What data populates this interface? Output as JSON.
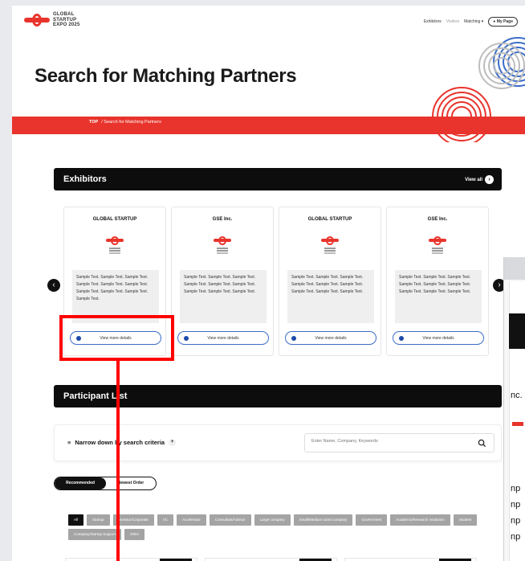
{
  "header": {
    "logo_text": [
      "GLOBAL",
      "STARTUP",
      "EXPO 2025"
    ],
    "nav": [
      "Exhibitors",
      "Visitors",
      "Matching",
      "My Page"
    ]
  },
  "hero": {
    "title": "Search for Matching Partners"
  },
  "breadcrumb": {
    "top": "TOP",
    "current": "Search for Matching Partners"
  },
  "exhibitors": {
    "title": "Exhibitors",
    "view_all": "View all",
    "cards": [
      {
        "name": "GLOBAL STARTUP",
        "desc": "Sample Text. Sample Text. Sample Text. Sample Text. Sample Text. Sample Text. Sample Text. Sample Text. Sample Text. Sample Text.",
        "button": "View more details"
      },
      {
        "name": "GSE Inc.",
        "desc": "Sample Text. Sample Text. Sample Text. Sample Text. Sample Text. Sample Text. Sample Text. Sample Text. Sample Text.",
        "button": "View more details"
      },
      {
        "name": "GLOBAL STARTUP",
        "desc": "Sample Text. Sample Text. Sample Text. Sample Text. Sample Text. Sample Text. Sample Text. Sample Text. Sample Text.",
        "button": "View more details"
      },
      {
        "name": "GSE Inc.",
        "desc": "Sample Text. Sample Text. Sample Text. Sample Text. Sample Text. Sample Text. Sample Text. Sample Text. Sample Text.",
        "button": "View more details"
      }
    ]
  },
  "participants": {
    "title": "Participant List",
    "narrow": "Narrow down by search criteria",
    "search_placeholder": "Enter Name, Company, Keywords",
    "sort": [
      "Recommended",
      "Newest Order"
    ],
    "tags": [
      "All",
      "Startup",
      "Investor/Corporate",
      "VC",
      "Accelerator",
      "Consultant/Advisor",
      "Large company",
      "Small/Medium sized company",
      "Government",
      "Academic/Research institution",
      "Student",
      "Company/Startup Support",
      "Other"
    ]
  },
  "overlay": {
    "lines": [
      "nc.",
      "np",
      "np",
      "np",
      "np"
    ]
  },
  "colors": {
    "brand_red": "#e8342c",
    "link_blue": "#3b6cc8",
    "highlight": "#ff0000"
  }
}
